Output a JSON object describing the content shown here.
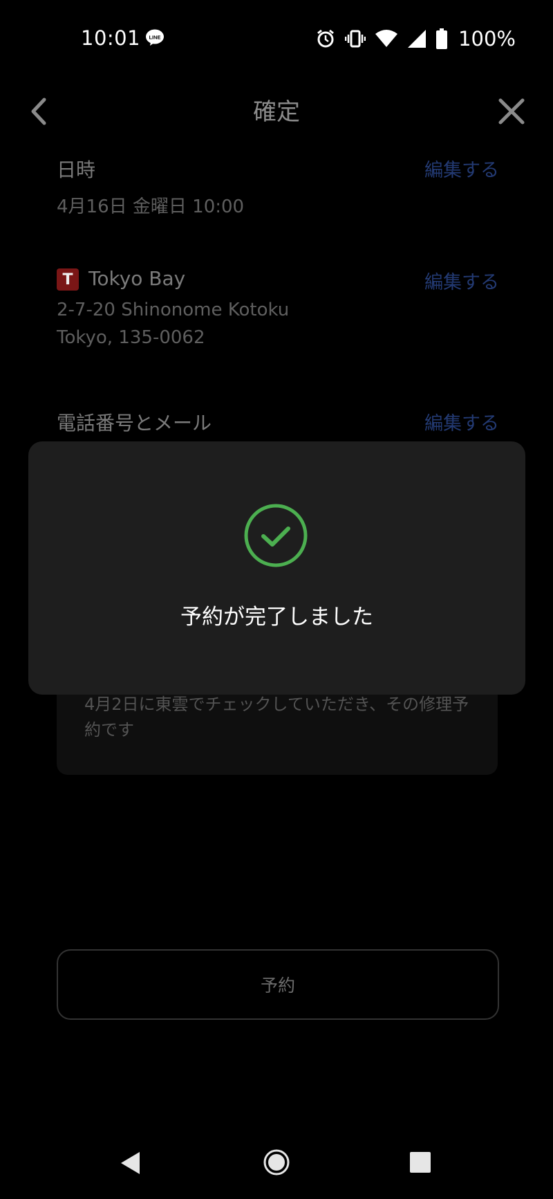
{
  "status_bar": {
    "time": "10:01",
    "battery": "100%",
    "line_badge": "LINE",
    "icons": [
      "line-icon",
      "alarm-icon",
      "vibrate-icon",
      "wifi-icon",
      "signal-icon",
      "battery-icon"
    ]
  },
  "header": {
    "title": "確定",
    "back_icon": "chevron-left-icon",
    "close_icon": "close-icon"
  },
  "datetime": {
    "label": "日時",
    "value": "4月16日 金曜日 10:00",
    "edit": "編集する"
  },
  "location": {
    "name": "Tokyo Bay",
    "address_line1": "2-7-20 Shinonome Kotoku",
    "address_line2": "Tokyo,  135-0062",
    "edit": "編集する",
    "logo_icon": "tesla-logo-icon"
  },
  "contact": {
    "label": "電話番号とメール",
    "edit": "編集する"
  },
  "notes": {
    "text": "4月2日に東雲でチェックしていただき、その修理予約です"
  },
  "actions": {
    "reserve_label": "予約"
  },
  "toast": {
    "message": "予約が完了しました",
    "icon": "check-circle-icon",
    "icon_color": "#4caf50"
  },
  "colors": {
    "background": "#000000",
    "toast_bg": "#1e1e1e",
    "accent_link": "#233a73",
    "success": "#4caf50"
  },
  "nav_bar": {
    "icons": [
      "nav-back-icon",
      "nav-home-icon",
      "nav-recents-icon"
    ]
  }
}
